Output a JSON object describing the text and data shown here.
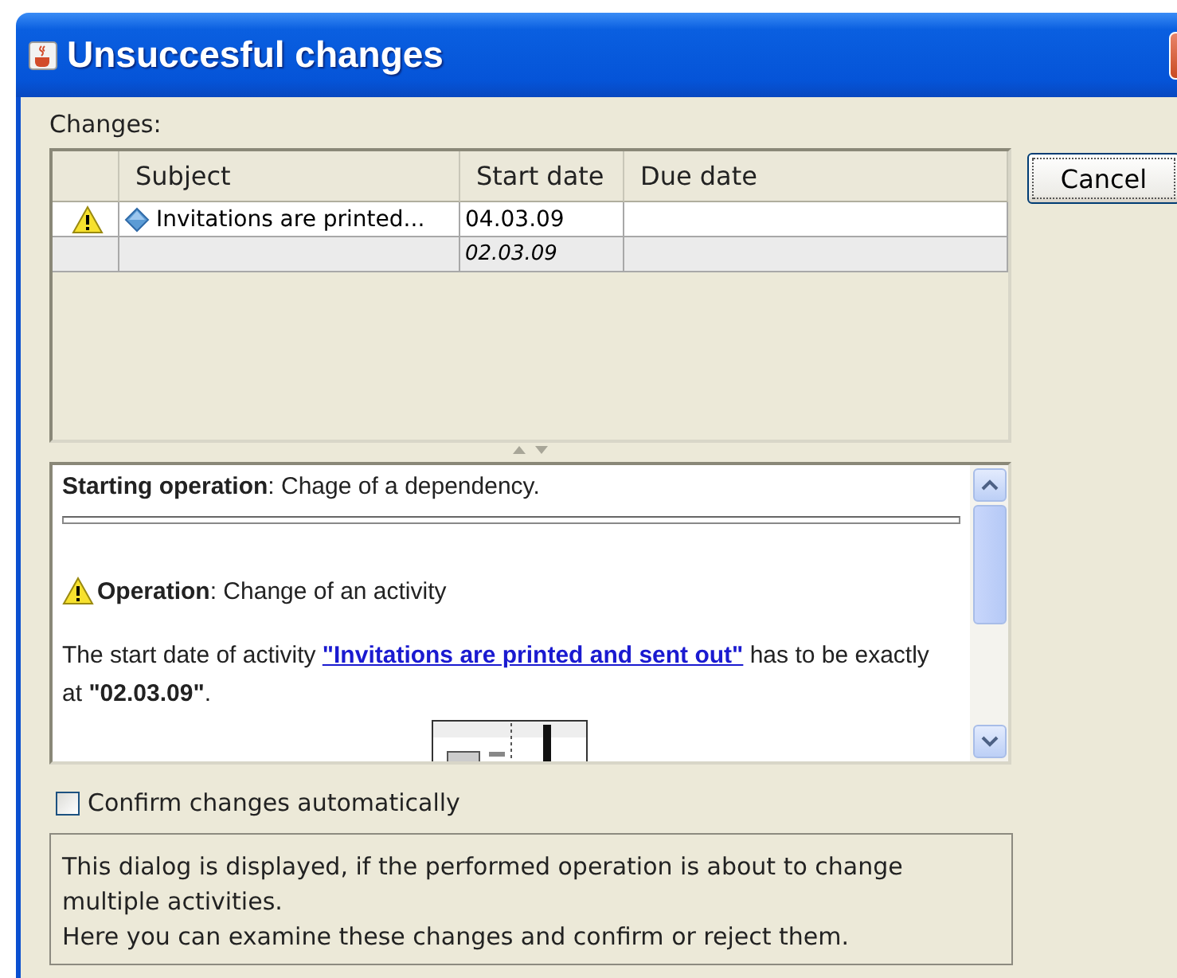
{
  "window": {
    "title": "Unsuccesful changes"
  },
  "changes_label": "Changes:",
  "table": {
    "columns": [
      "Subject",
      "Start date",
      "Due date"
    ],
    "rows": [
      {
        "kind": "activity",
        "warning": true,
        "subject": "Invitations are printed...",
        "start_date": "04.03.09"
      },
      {
        "kind": "change",
        "warning": false,
        "start_date": "02.03.09"
      }
    ]
  },
  "cancel_button": "Cancel",
  "details": {
    "starting_operation": "**Starting operation**: Chage of a dependency.",
    "operation": "**Operation**: Change of an activity",
    "message": {
      "before": "The start date of activity ",
      "link": "\"Invitations are printed and sent out\"",
      "after": " has to be exactly at **\"02.03.09\"**."
    }
  },
  "confirm_automatically": {
    "label": "Confirm changes automatically",
    "checked": false
  },
  "info": [
    "This dialog is displayed, if the performed operation is about to change multiple activities.",
    "Here you can examine these changes and confirm or reject them."
  ]
}
